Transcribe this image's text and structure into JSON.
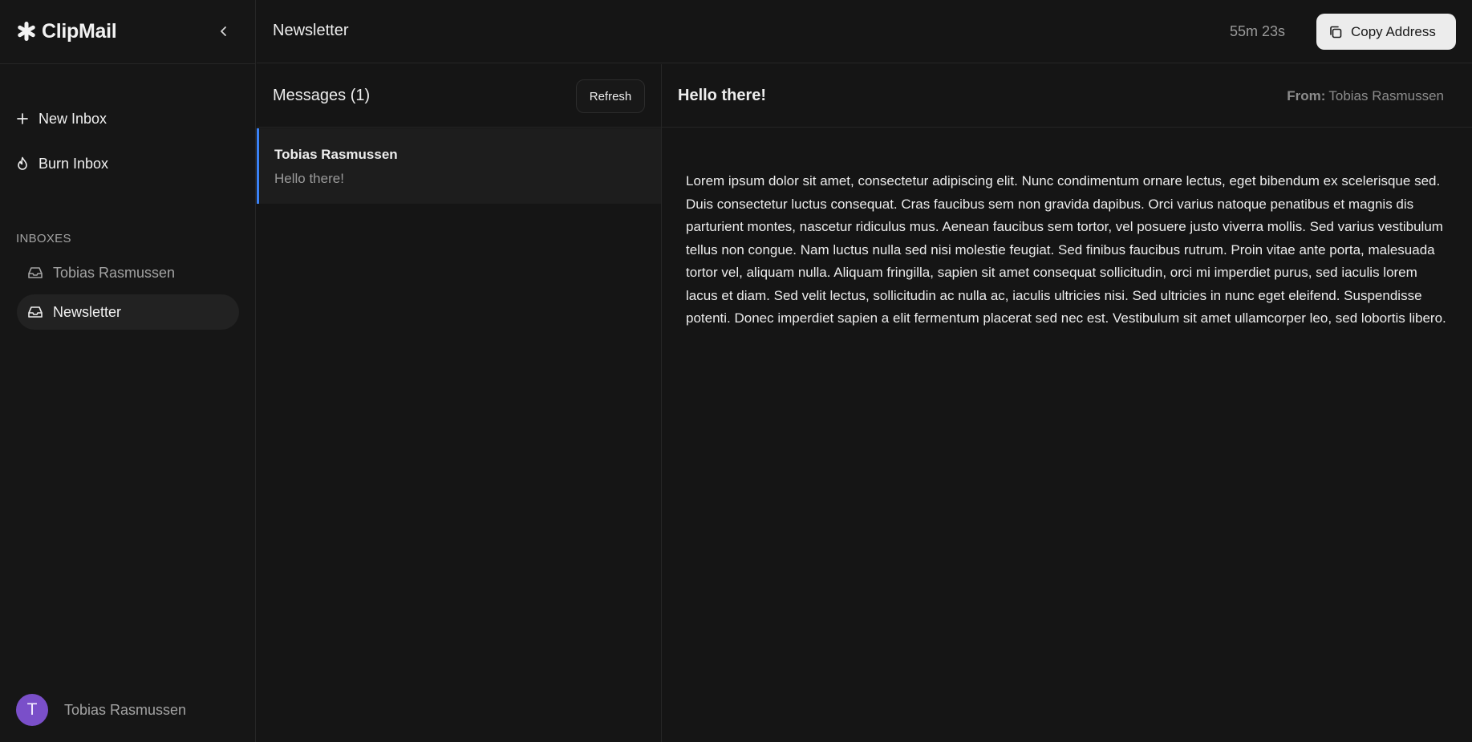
{
  "app": {
    "name": "ClipMail"
  },
  "sidebar": {
    "actions": [
      {
        "label": "New Inbox",
        "icon": "plus-icon"
      },
      {
        "label": "Burn Inbox",
        "icon": "flame-icon"
      }
    ],
    "section_label": "INBOXES",
    "inboxes": [
      {
        "label": "Tobias Rasmussen",
        "icon": "inbox-icon",
        "selected": false
      },
      {
        "label": "Newsletter",
        "icon": "inbox-icon",
        "selected": true
      }
    ],
    "user": {
      "initial": "T",
      "name": "Tobias Rasmussen"
    }
  },
  "header": {
    "title": "Newsletter",
    "timer": "55m 23s",
    "copy_label": "Copy Address"
  },
  "messages": {
    "title": "Messages (1)",
    "refresh_label": "Refresh",
    "items": [
      {
        "from": "Tobias Rasmussen",
        "subject": "Hello there!"
      }
    ]
  },
  "reader": {
    "subject": "Hello there!",
    "from_label": "From:",
    "from": "Tobias Rasmussen",
    "body": "Lorem ipsum dolor sit amet, consectetur adipiscing elit. Nunc condimentum ornare lectus, eget bibendum ex scelerisque sed. Duis consectetur luctus consequat. Cras faucibus sem non gravida dapibus. Orci varius natoque penatibus et magnis dis parturient montes, nascetur ridiculus mus. Aenean faucibus sem tortor, vel posuere justo viverra mollis. Sed varius vestibulum tellus non congue. Nam luctus nulla sed nisi molestie feugiat. Sed finibus faucibus rutrum. Proin vitae ante porta, malesuada tortor vel, aliquam nulla. Aliquam fringilla, sapien sit amet consequat sollicitudin, orci mi imperdiet purus, sed iaculis lorem lacus et diam. Sed velit lectus, sollicitudin ac nulla ac, iaculis ultricies nisi. Sed ultricies in nunc eget eleifend. Suspendisse potenti. Donec imperdiet sapien a elit fermentum placerat sed nec est. Vestibulum sit amet ullamcorper leo, sed lobortis libero."
  },
  "colors": {
    "background": "#151515",
    "accent": "#3b82f6",
    "avatar": "#7a4fc9"
  }
}
